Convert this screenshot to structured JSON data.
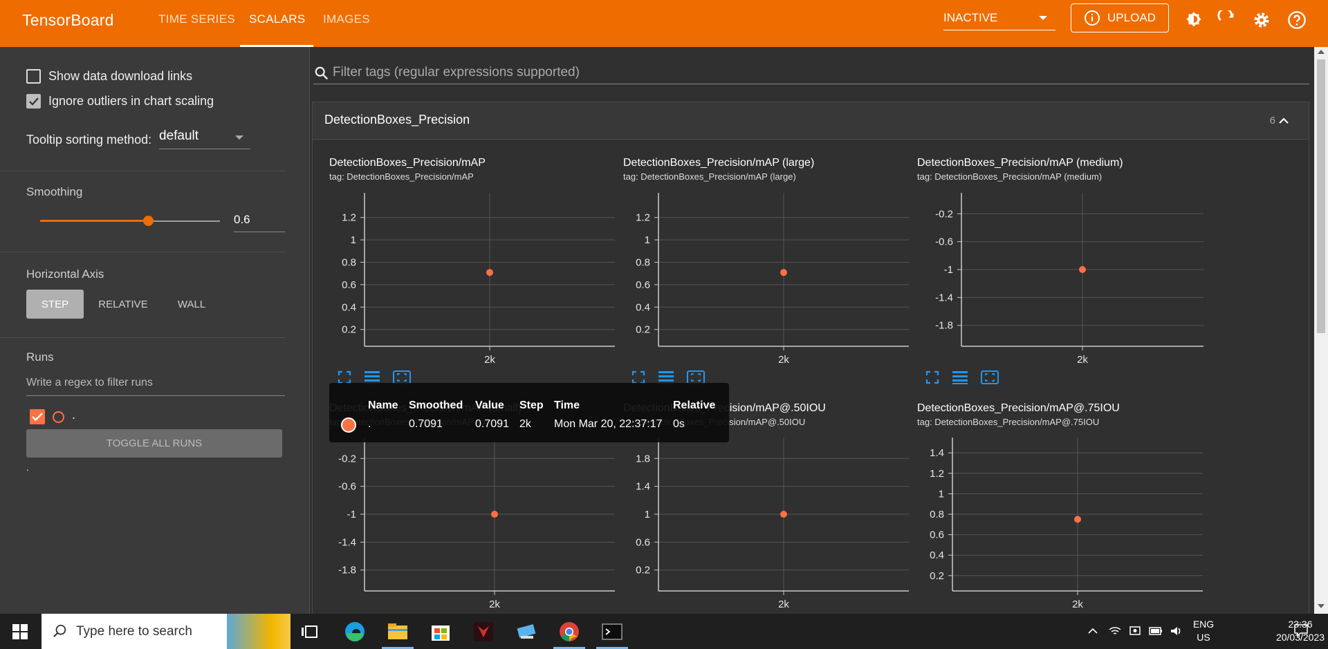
{
  "header": {
    "brand": "TensorBoard",
    "tabs": [
      {
        "label": "TIME SERIES",
        "active": false
      },
      {
        "label": "SCALARS",
        "active": true
      },
      {
        "label": "IMAGES",
        "active": false
      }
    ],
    "run_state": "INACTIVE",
    "upload_label": "UPLOAD",
    "accent_color": "#ef6c00"
  },
  "sidebar": {
    "show_download_links": {
      "label": "Show data download links",
      "checked": false
    },
    "ignore_outliers": {
      "label": "Ignore outliers in chart scaling",
      "checked": true
    },
    "tooltip_sorting": {
      "label": "Tooltip sorting method:",
      "value": "default"
    },
    "smoothing": {
      "label": "Smoothing",
      "value": "0.6",
      "slider_fraction": 0.6
    },
    "horizontal_axis": {
      "label": "Horizontal Axis",
      "options": [
        "STEP",
        "RELATIVE",
        "WALL"
      ],
      "selected": "STEP"
    },
    "runs": {
      "label": "Runs",
      "filter_placeholder": "Write a regex to filter runs",
      "items": [
        {
          "name": ".",
          "checked": true,
          "color": "#ff7043"
        }
      ],
      "toggle_all_label": "TOGGLE ALL RUNS",
      "footer_text": "."
    }
  },
  "main": {
    "filter_placeholder": "Filter tags (regular expressions supported)",
    "group": {
      "title": "DetectionBoxes_Precision",
      "count": "6"
    }
  },
  "chart_data": [
    {
      "type": "scatter",
      "title": "DetectionBoxes_Precision/mAP",
      "tag": "tag: DetectionBoxes_Precision/mAP",
      "x_ticks": [
        "2k"
      ],
      "y_ticks": [
        0.2,
        0.4,
        0.6,
        0.8,
        1,
        1.2
      ],
      "ylim": [
        0.05,
        1.42
      ],
      "series": [
        {
          "name": ".",
          "x": [
            2000
          ],
          "y": [
            0.7091
          ]
        }
      ]
    },
    {
      "type": "scatter",
      "title": "DetectionBoxes_Precision/mAP (large)",
      "tag": "tag: DetectionBoxes_Precision/mAP (large)",
      "x_ticks": [
        "2k"
      ],
      "y_ticks": [
        0.2,
        0.4,
        0.6,
        0.8,
        1,
        1.2
      ],
      "ylim": [
        0.05,
        1.42
      ],
      "series": [
        {
          "name": ".",
          "x": [
            2000
          ],
          "y": [
            0.7091
          ]
        }
      ]
    },
    {
      "type": "scatter",
      "title": "DetectionBoxes_Precision/mAP (medium)",
      "tag": "tag: DetectionBoxes_Precision/mAP (medium)",
      "x_ticks": [
        "2k"
      ],
      "y_ticks": [
        -1.8,
        -1.4,
        -1,
        -0.6,
        -0.2
      ],
      "ylim": [
        -2.1,
        0.1
      ],
      "series": [
        {
          "name": ".",
          "x": [
            2000
          ],
          "y": [
            -1
          ]
        }
      ]
    },
    {
      "type": "scatter",
      "title": "DetectionBoxes_Precision/mAP (small)",
      "tag": "tag: DetectionBoxes_Precision/mAP (small)",
      "x_ticks": [
        "2k"
      ],
      "y_ticks": [
        -1.8,
        -1.4,
        -1,
        -0.6,
        -0.2
      ],
      "ylim": [
        -2.1,
        0.1
      ],
      "series": [
        {
          "name": ".",
          "x": [
            2000
          ],
          "y": [
            -1
          ]
        }
      ]
    },
    {
      "type": "scatter",
      "title": "DetectionBoxes_Precision/mAP@.50IOU",
      "tag": "tag: DetectionBoxes_Precision/mAP@.50IOU",
      "x_ticks": [
        "2k"
      ],
      "y_ticks": [
        0.2,
        0.6,
        1,
        1.4,
        1.8
      ],
      "ylim": [
        -0.1,
        2.1
      ],
      "series": [
        {
          "name": ".",
          "x": [
            2000
          ],
          "y": [
            1
          ]
        }
      ]
    },
    {
      "type": "scatter",
      "title": "DetectionBoxes_Precision/mAP@.75IOU",
      "tag": "tag: DetectionBoxes_Precision/mAP@.75IOU",
      "x_ticks": [
        "2k"
      ],
      "y_ticks": [
        0.2,
        0.4,
        0.6,
        0.8,
        1,
        1.2,
        1.4
      ],
      "ylim": [
        0.05,
        1.55
      ],
      "series": [
        {
          "name": ".",
          "x": [
            2000
          ],
          "y": [
            0.75
          ]
        }
      ]
    }
  ],
  "tooltip": {
    "headers": [
      "Name",
      "Smoothed",
      "Value",
      "Step",
      "Time",
      "Relative"
    ],
    "row": {
      "name": ".",
      "smoothed": "0.7091",
      "value": "0.7091",
      "step": "2k",
      "time": "Mon Mar 20, 22:37:17",
      "relative": "0s"
    }
  },
  "taskbar": {
    "search_placeholder": "Type here to search",
    "lang": [
      "ENG",
      "US"
    ],
    "time": "23:36",
    "date": "20/03/2023"
  }
}
